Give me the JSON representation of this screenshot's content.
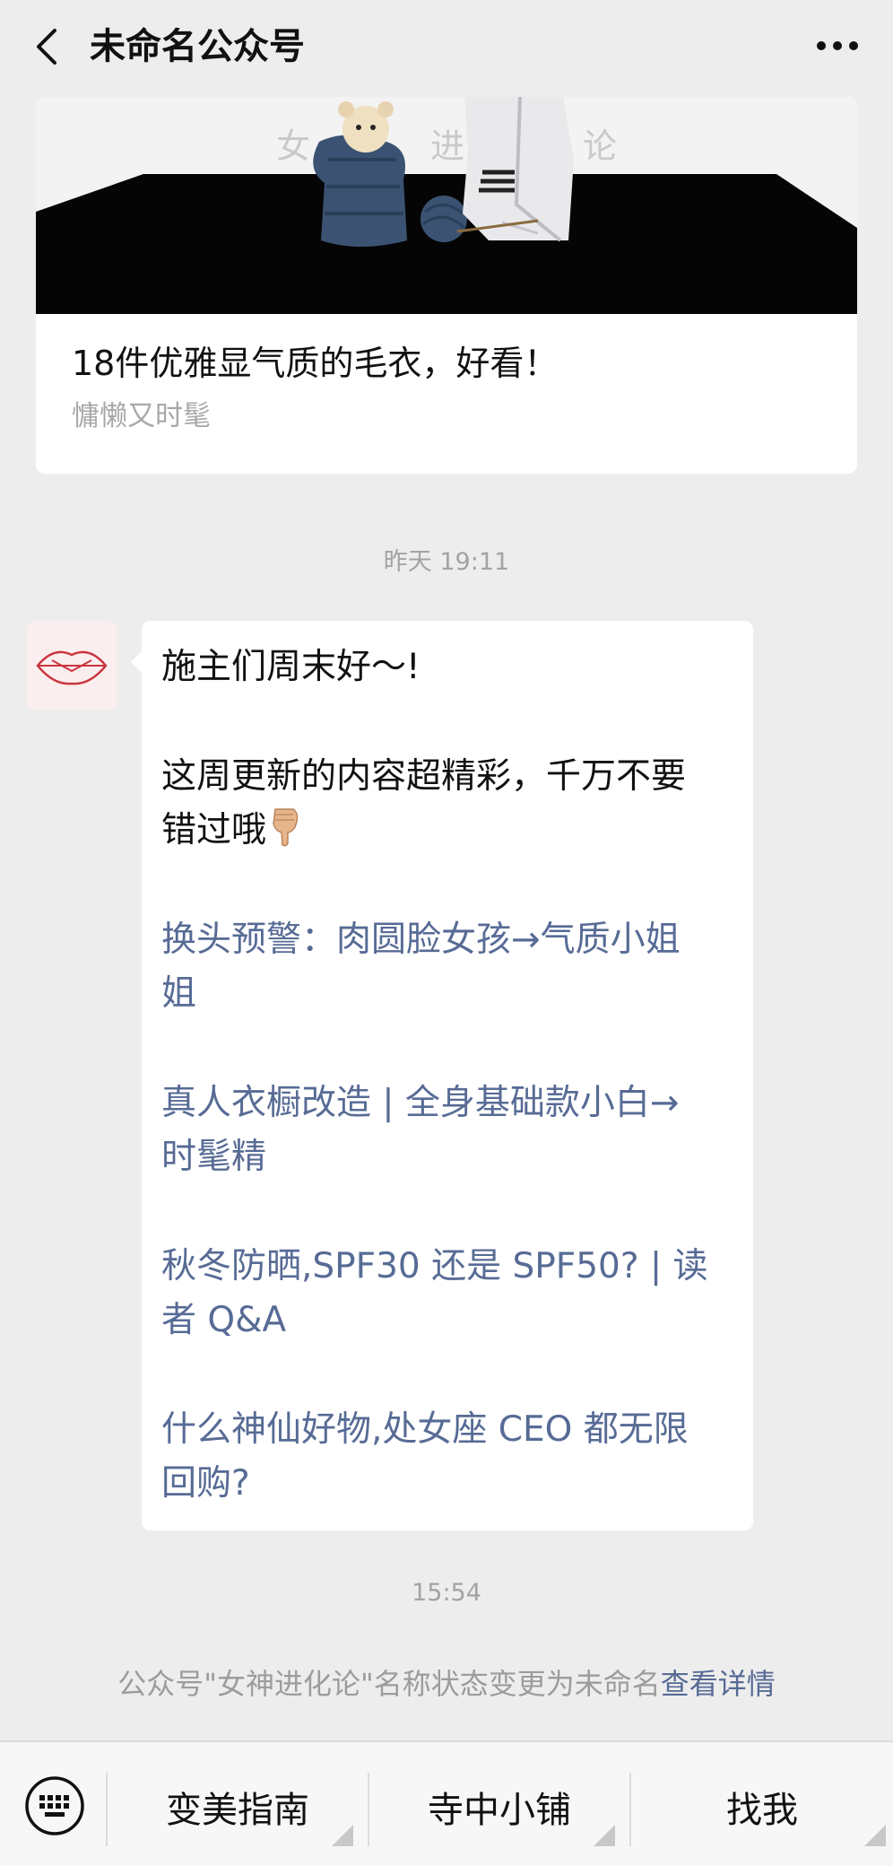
{
  "header": {
    "title": "未命名公众号",
    "back_icon": "chevron-left-icon",
    "more_icon": "more-horizontal-icon"
  },
  "article": {
    "cover_text": [
      "女",
      "进",
      "论"
    ],
    "title": "18件优雅显气质的毛衣，好看！",
    "subtitle": "慵懒又时髦"
  },
  "timestamps": {
    "first": "昨天 19:11",
    "second": "15:54"
  },
  "message": {
    "avatar_icon": "lips-logo-icon",
    "lines": [
      "施主们周末好～!",
      "这周更新的内容超精彩，千万不要",
      "错过哦",
      "换头预警：肉圆脸女孩→气质小姐",
      "姐",
      "真人衣橱改造 | 全身基础款小白→",
      "时髦精",
      "秋冬防晒,SPF30 还是 SPF50? | 读",
      "者 Q&A",
      "什么神仙好物,处女座 CEO 都无限",
      "回购?"
    ],
    "emoji": "backhand-pointing-down-emoji"
  },
  "system_notice": {
    "text": "公众号\"女神进化论\"名称状态变更为未命名",
    "link": "查看详情"
  },
  "bottom_menu": {
    "keyboard_icon": "keyboard-icon",
    "items": [
      "变美指南",
      "寺中小铺",
      "找我"
    ]
  },
  "colors": {
    "link": "#576b95",
    "background": "#ededed",
    "bubble": "#ffffff",
    "avatar_accent": "#c9353f"
  }
}
